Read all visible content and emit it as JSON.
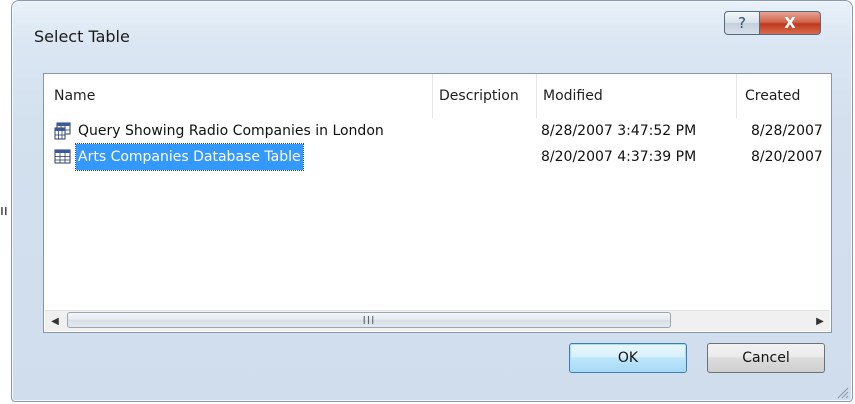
{
  "background_fragment": "ıı",
  "dialog": {
    "title": "Select Table",
    "help_glyph": "?",
    "close_glyph": "X"
  },
  "list": {
    "columns": [
      "Name",
      "Description",
      "Modified",
      "Created"
    ],
    "rows": [
      {
        "icon": "query-icon",
        "name": "Query Showing Radio Companies in London",
        "description": "",
        "modified": "8/28/2007 3:47:52 PM",
        "created": "8/28/2007",
        "selected": false
      },
      {
        "icon": "table-icon",
        "name": "Arts Companies Database Table",
        "description": "",
        "modified": "8/20/2007 4:37:39 PM",
        "created": "8/20/2007",
        "selected": true
      }
    ],
    "scrollbar": {
      "left_arrow": "◀",
      "right_arrow": "▶",
      "thumb_grip": "III"
    }
  },
  "buttons": {
    "ok": "OK",
    "cancel": "Cancel"
  },
  "colors": {
    "selection": "#3399ff",
    "close_button": "#c0391d"
  }
}
